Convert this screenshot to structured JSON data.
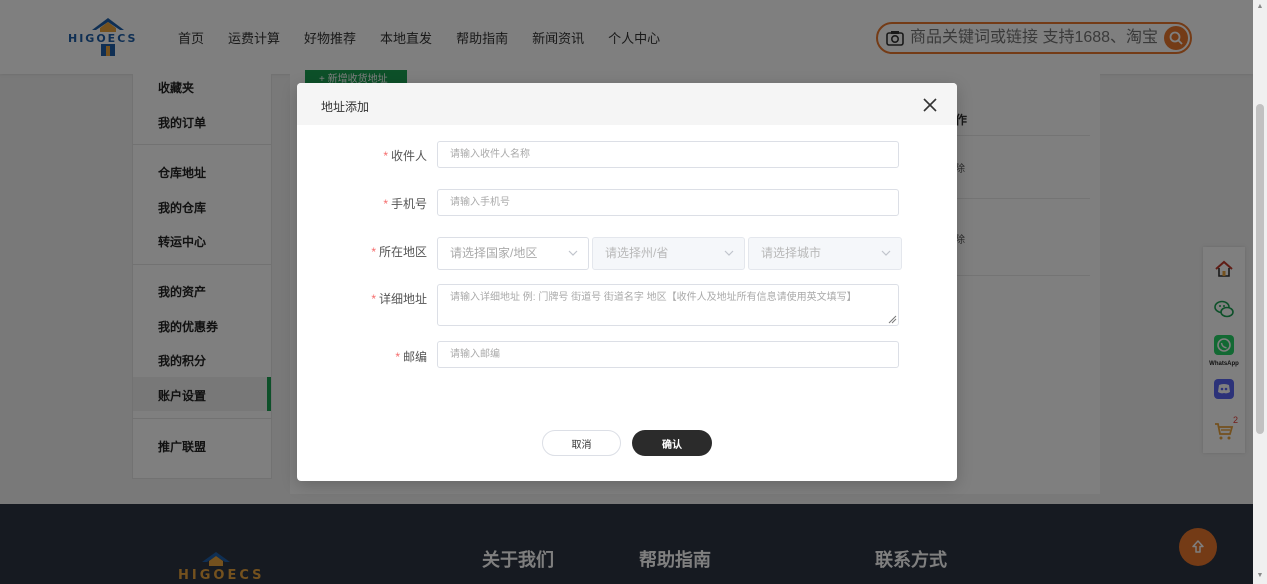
{
  "header": {
    "logo_text": "HIGOECS",
    "nav": [
      "首页",
      "运费计算",
      "好物推荐",
      "本地直发",
      "帮助指南",
      "新闻资讯",
      "个人中心"
    ],
    "search": {
      "placeholder": "商品关键词或链接 支持1688、淘宝"
    }
  },
  "sidebar": {
    "items": [
      "收藏夹",
      "我的订单",
      "仓库地址",
      "我的仓库",
      "转运中心",
      "我的资产",
      "我的优惠券",
      "我的积分",
      "账户设置",
      "推广联盟"
    ],
    "active": "账户设置"
  },
  "content": {
    "add_button": "+ 新增收货地址",
    "column_header": "作",
    "row_actions": [
      "除",
      "除"
    ]
  },
  "modal": {
    "title": "地址添加",
    "fields": {
      "recipient": {
        "label": "收件人",
        "placeholder": "请输入收件人名称"
      },
      "phone": {
        "label": "手机号",
        "placeholder": "请输入手机号"
      },
      "region": {
        "label": "所在地区",
        "country_placeholder": "请选择国家/地区",
        "state_placeholder": "请选择州/省",
        "city_placeholder": "请选择城市"
      },
      "address": {
        "label": "详细地址",
        "placeholder": "请输入详细地址 例: 门牌号 街道号 街道名字 地区【收件人及地址所有信息请使用英文填写】"
      },
      "zipcode": {
        "label": "邮编",
        "placeholder": "请输入邮编"
      }
    },
    "required_mark": "*",
    "cancel_label": "取消",
    "confirm_label": "确认"
  },
  "floating_bar": {
    "icons": [
      "home-icon",
      "wechat-icon",
      "whatsapp-icon",
      "discord-icon",
      "cart-icon"
    ],
    "whatsapp_label": "WhatsApp",
    "cart_count": "2"
  },
  "footer": {
    "logo_text": "HIGOECS",
    "columns": [
      "关于我们",
      "帮助指南",
      "联系方式"
    ]
  },
  "colors": {
    "accent_orange": "#e8762d",
    "active_green": "#1aa053",
    "footer_bg": "#2c3442",
    "required_red": "#f56c6c"
  }
}
